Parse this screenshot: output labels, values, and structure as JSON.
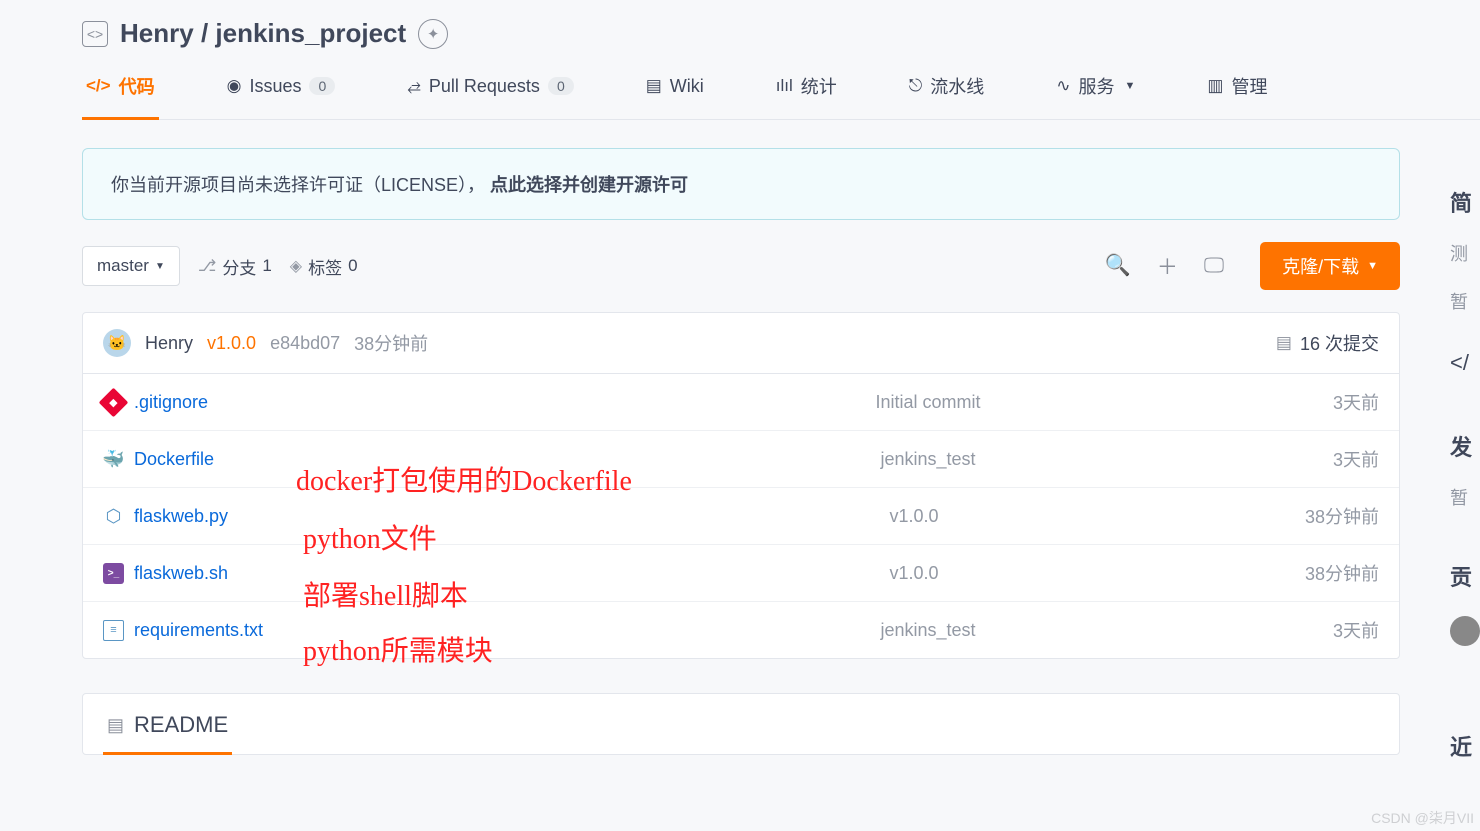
{
  "header": {
    "owner": "Henry",
    "sep": "/",
    "repo": "jenkins_project"
  },
  "tabs": {
    "code": "代码",
    "issues": "Issues",
    "issues_count": "0",
    "pulls": "Pull Requests",
    "pulls_count": "0",
    "wiki": "Wiki",
    "stats": "统计",
    "pipeline": "流水线",
    "services": "服务",
    "manage": "管理"
  },
  "notice": {
    "text": "你当前开源项目尚未选择许可证（LICENSE），",
    "action": "点此选择并创建开源许可"
  },
  "toolbar": {
    "branch": "master",
    "branches_label": "分支",
    "branches_count": "1",
    "tags_label": "标签",
    "tags_count": "0",
    "clone": "克隆/下载"
  },
  "commit": {
    "author": "Henry",
    "version": "v1.0.0",
    "hash": "e84bd07",
    "time": "38分钟前",
    "count_label": "16 次提交"
  },
  "files": [
    {
      "icon": "gitignore",
      "name": ".gitignore",
      "msg": "Initial commit",
      "time": "3天前"
    },
    {
      "icon": "docker",
      "name": "Dockerfile",
      "msg": "jenkins_test",
      "time": "3天前"
    },
    {
      "icon": "python",
      "name": "flaskweb.py",
      "msg": "v1.0.0",
      "time": "38分钟前"
    },
    {
      "icon": "shell",
      "name": "flaskweb.sh",
      "msg": "v1.0.0",
      "time": "38分钟前"
    },
    {
      "icon": "txt",
      "name": "requirements.txt",
      "msg": "jenkins_test",
      "time": "3天前"
    }
  ],
  "readme": {
    "label": "README"
  },
  "side": {
    "summary": "简",
    "sub1": "测",
    "sub2": "暂",
    "release": "发",
    "sub3": "暂",
    "contrib": "贡",
    "recent": "近"
  },
  "annotations": {
    "dockerfile": "docker打包使用的Dockerfile",
    "python": "python文件",
    "shell": "部署shell脚本",
    "req": "python所需模块"
  },
  "watermark": "CSDN @柒月VII"
}
